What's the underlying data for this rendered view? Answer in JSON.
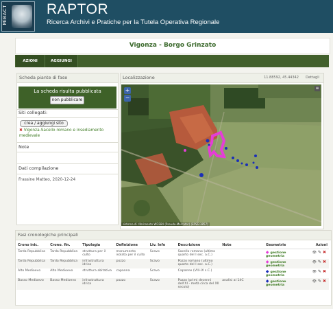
{
  "header": {
    "logo_text": "MiBACT",
    "title": "RAPTOR",
    "subtitle": "Ricerca Archivi e Pratiche per la Tutela Operativa Regionale"
  },
  "page_title": "Vigonza - Borgo Grinzato",
  "nav": {
    "azioni": "AZIONI",
    "aggiungi": "AGGIUNGI"
  },
  "left": {
    "panel_title": "Scheda piante di fase",
    "published_text": "La scheda risulta pubblicata",
    "unpublish_button": "non pubblicare",
    "linked_sites_title": "Siti collegati:",
    "add_site_button": "crea / aggiungi sito",
    "linked_site": "Vigonza-Sacello romano e insediamento medievale",
    "notes_title": "Note",
    "compilation_title": "Dati compilazione",
    "compilation_value": "Frassine Matteo, 2020-12-24"
  },
  "map": {
    "title": "Localizzazione",
    "coords": "11.88592, 45.44342",
    "details": "Dettagli",
    "zoom_in": "+",
    "zoom_out": "−",
    "attribution": "sistema di riferimento WGS84 (Pseudo-Mercator) (EPSG:3857)"
  },
  "phases": {
    "title": "Fasi cronologiche principali",
    "columns": [
      "Crono inic.",
      "Crono. fin.",
      "Tipologia",
      "Definizione",
      "Liv. Info",
      "Descrizione",
      "Note",
      "Geometrie",
      "Azioni"
    ],
    "rows": [
      {
        "crono_ini": "Tarda Repubblica",
        "crono_fin": "Tarda Repubblica",
        "tipologia": "struttura per il culto",
        "definizione": "monumento isolato per il culto",
        "liv_info": "Scavo",
        "descrizione": "Sacello romano (ultimo quarto del I sec. a.C.)",
        "note": "",
        "geometria": "gestione geometria",
        "geom_color": "#e53dd6"
      },
      {
        "crono_ini": "Tarda Repubblica",
        "crono_fin": "Tarda Repubblica",
        "tipologia": "infrastruttura idrica",
        "definizione": "pozzo",
        "liv_info": "Scavo",
        "descrizione": "Pozzo romano (ultimo quarto del I sec. a.C.)",
        "note": "",
        "geometria": "gestione geometria",
        "geom_color": "#e53dd6"
      },
      {
        "crono_ini": "Alto Medioevo",
        "crono_fin": "Alto Medioevo",
        "tipologia": "struttura abitativa",
        "definizione": "capanna",
        "liv_info": "Scavo",
        "descrizione": "Capanne (VIII-IX s.C.)",
        "note": "",
        "geometria": "gestione geometria",
        "geom_color": "#1b2fb8"
      },
      {
        "crono_ini": "Basso Medioevo",
        "crono_fin": "Basso Medioevo",
        "tipologia": "infrastruttura idrica",
        "definizione": "pozzo",
        "liv_info": "Scavo",
        "descrizione": "Pozzo (primi decenni dell'XI - metà circa del XII secolo)",
        "note": "analisi al 14C",
        "geometria": "gestione geometria",
        "geom_color": "#1b2fb8"
      }
    ]
  }
}
